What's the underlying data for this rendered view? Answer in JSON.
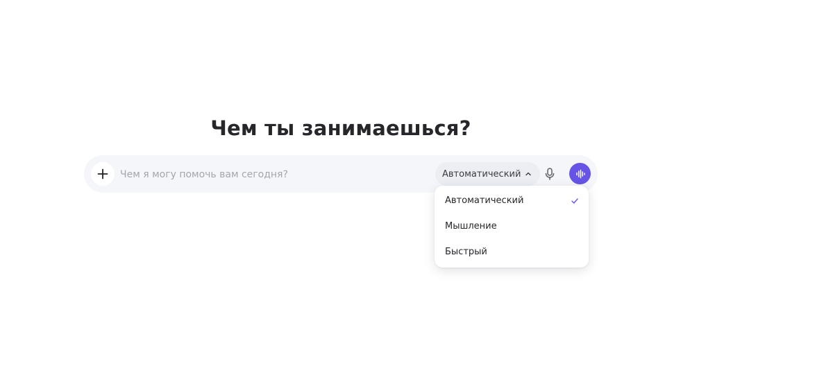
{
  "headline": "Чем ты занимаешься?",
  "composer": {
    "placeholder": "Чем я могу помочь вам сегодня?",
    "add_icon": "plus-icon",
    "mic_icon": "microphone-icon",
    "voice_icon": "waveform-icon"
  },
  "mode": {
    "selected": "Автоматический",
    "chevron_icon": "chevron-up-icon",
    "options": [
      {
        "label": "Автоматический",
        "selected": true
      },
      {
        "label": "Мышление",
        "selected": false
      },
      {
        "label": "Быстрый",
        "selected": false
      }
    ]
  },
  "colors": {
    "accent": "#6654e6",
    "composer_bg": "#f5f6fa",
    "placeholder": "#a4a6ae"
  }
}
